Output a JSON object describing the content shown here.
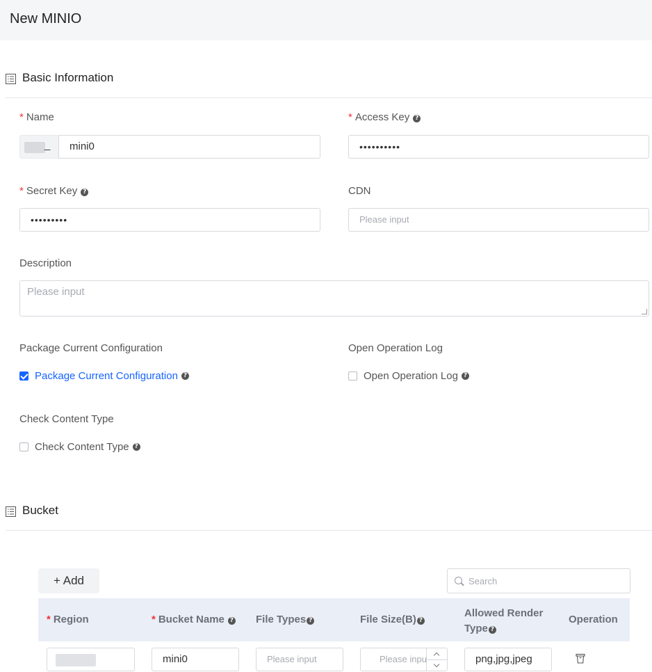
{
  "page": {
    "title": "New MINIO"
  },
  "basic": {
    "section_title": "Basic Information",
    "name": {
      "label": "Name",
      "prefix_suffix": "_",
      "value": "mini0"
    },
    "access_key": {
      "label": "Access Key",
      "value": "••••••••••"
    },
    "secret_key": {
      "label": "Secret Key",
      "value": "•••••••••"
    },
    "cdn": {
      "label": "CDN",
      "placeholder": "Please input"
    },
    "description": {
      "label": "Description",
      "placeholder": "Please input"
    },
    "package": {
      "label": "Package Current Configuration",
      "checkbox_label": "Package Current Configuration",
      "checked": true
    },
    "operation_log": {
      "label": "Open Operation Log",
      "checkbox_label": "Open Operation Log",
      "checked": false
    },
    "content_type": {
      "label": "Check Content Type",
      "checkbox_label": "Check Content Type",
      "checked": false
    }
  },
  "bucket": {
    "section_title": "Bucket",
    "add_label": "+ Add",
    "search_placeholder": "Search",
    "columns": {
      "region": "Region",
      "bucket_name": "Bucket Name",
      "file_types": "File Types",
      "file_size": "File Size(B)",
      "allowed_render_type_1": "Allowed Render",
      "allowed_render_type_2": "Type",
      "operation": "Operation"
    },
    "row": {
      "bucket_name": "mini0",
      "file_types_placeholder": "Please input",
      "file_size_placeholder": "Please input",
      "allowed_render_type": "png,jpg,jpeg"
    }
  },
  "colors": {
    "accent": "#1664ff",
    "required": "#f0323c",
    "header_bg": "#f5f6f8",
    "table_header_bg": "#eaeef6"
  }
}
